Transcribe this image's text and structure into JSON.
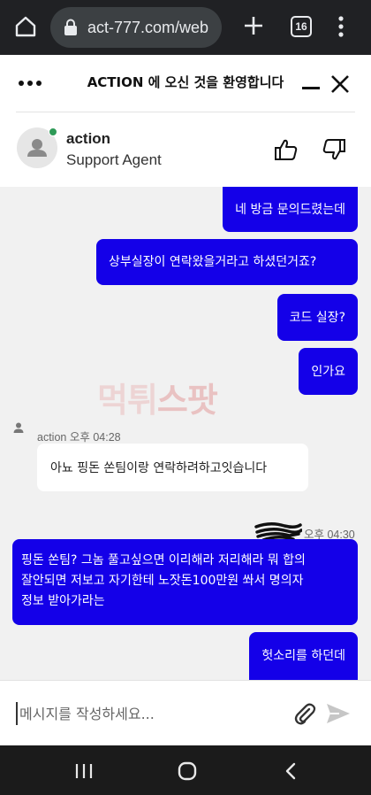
{
  "browser": {
    "url": "act-777.com/web",
    "tab_count": "16"
  },
  "chat_header": {
    "title": "ACTION 에 오신 것을 환영합니다",
    "agent_name": "action",
    "agent_role": "Support Agent",
    "status_color": "#2e9a57"
  },
  "messages": [
    {
      "from": "user",
      "text": "네 방금 문의드렸는데"
    },
    {
      "from": "user",
      "text": "상부실장이 연락왔을거라고 하셨던거죠?"
    },
    {
      "from": "user",
      "text": "코드 실장?"
    },
    {
      "from": "user",
      "text": "인가요"
    },
    {
      "from": "agent",
      "sender": "action",
      "time": "오후 04:28",
      "text": "아뇨 핑돈 쏜팀이랑 연락하려하고잇습니다"
    },
    {
      "from": "user",
      "time": "오후 04:30",
      "lines": [
        "핑돈 쏜팀? 그놈 풀고싶으면 이리해라 저리해라 뭐 합의",
        "잘안되면 저보고 자기한테 노잣돈100만원 쏴서 명의자",
        "정보 받아가라는"
      ]
    },
    {
      "from": "user",
      "text": "헛소리를 하던데"
    }
  ],
  "watermark": {
    "part1": "먹튀",
    "part2": "스팟"
  },
  "input": {
    "placeholder": "메시지를 작성하세요..."
  },
  "colors": {
    "user_bubble": "#1400e8",
    "agent_bubble": "#ffffff",
    "chat_bg": "#f1f1f1"
  },
  "icons": [
    "home-icon",
    "lock-icon",
    "plus-icon",
    "tab-count-icon",
    "more-vert-icon",
    "more-horiz-icon",
    "minimize-icon",
    "close-icon",
    "user-avatar-icon",
    "thumbs-up-icon",
    "thumbs-down-icon",
    "attach-icon",
    "send-icon",
    "recent-apps-icon",
    "home-circle-icon",
    "back-icon"
  ]
}
